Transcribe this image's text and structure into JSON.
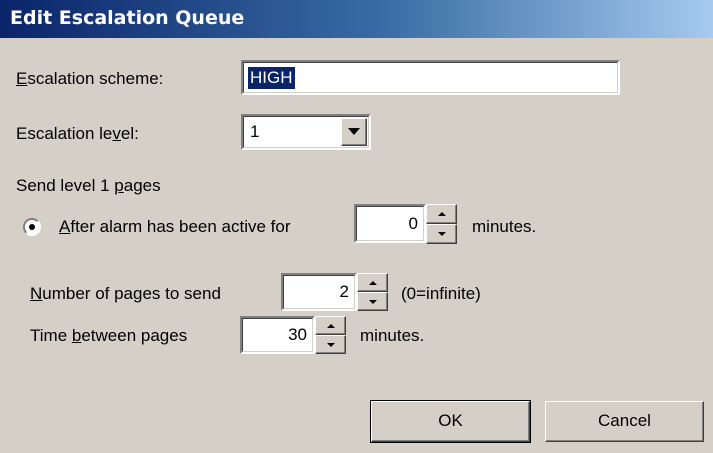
{
  "window": {
    "title": "Edit Escalation Queue"
  },
  "scheme": {
    "label_key": "E",
    "label_rest": "scalation scheme:",
    "value": "HIGH"
  },
  "level": {
    "label_pre": "Escalation le",
    "label_key": "v",
    "label_post": "el:",
    "value": "1"
  },
  "send": {
    "pre": "Send level 1 ",
    "key": "p",
    "post": "ages"
  },
  "after": {
    "key": "A",
    "rest": "fter alarm has been active for",
    "value": "0",
    "suffix": "minutes."
  },
  "pages": {
    "key": "N",
    "rest": "umber of pages to send",
    "value": "2",
    "suffix": "(0=infinite)"
  },
  "between": {
    "pre": "Time ",
    "key": "b",
    "post": "etween pages",
    "value": "30",
    "suffix": "minutes."
  },
  "buttons": {
    "ok": "OK",
    "cancel": "Cancel"
  }
}
